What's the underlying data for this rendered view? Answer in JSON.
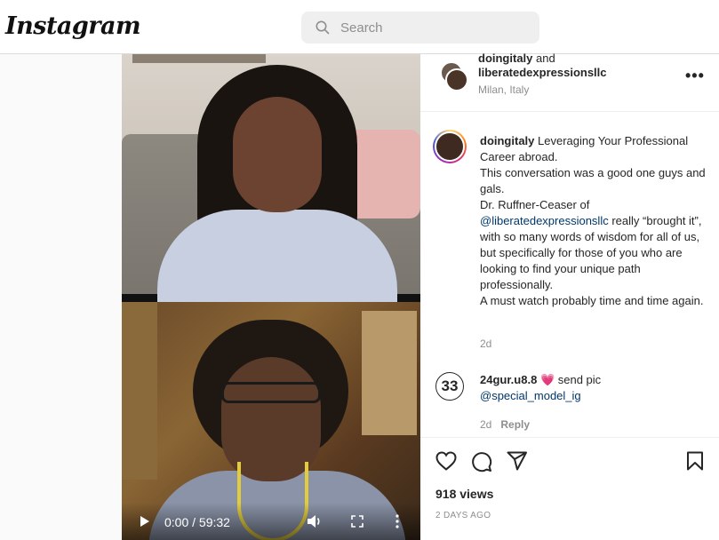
{
  "app": {
    "logo": "Instagram"
  },
  "search": {
    "placeholder": "Search",
    "icon": "search-icon"
  },
  "video": {
    "current_time": "0:00",
    "duration": "59:32",
    "time_display": "0:00 / 59:32"
  },
  "post": {
    "header": {
      "user1": "doingitaly",
      "and": " and",
      "user2": "liberatedexpressionsllc",
      "location": "Milan, Italy",
      "more": "•••"
    },
    "caption": {
      "username": "doingitaly",
      "line1": " Leveraging Your Professional Career abroad.",
      "line2": "This conversation was a good one guys and gals.",
      "line3a": "Dr. Ruffner-Ceaser of ",
      "mention": "@liberatedexpressionsllc",
      "line3b": " really “brought it”, with so many words of wisdom for all of us, but specifically for those of you who are looking to find your unique path professionally.",
      "line4": "A must watch probably time and time again.",
      "time": "2d"
    },
    "comment": {
      "avatar_text": "33",
      "username": "24gur.u8.8",
      "emoji": "💗",
      "text": " send pic",
      "mention": "@special_model_ig",
      "time": "2d",
      "reply": "Reply"
    },
    "views": "918 views",
    "date": "2 DAYS AGO"
  },
  "colors": {
    "link": "#00376b",
    "muted": "#8e8e8e",
    "text": "#262626",
    "border": "#dbdbdb"
  }
}
